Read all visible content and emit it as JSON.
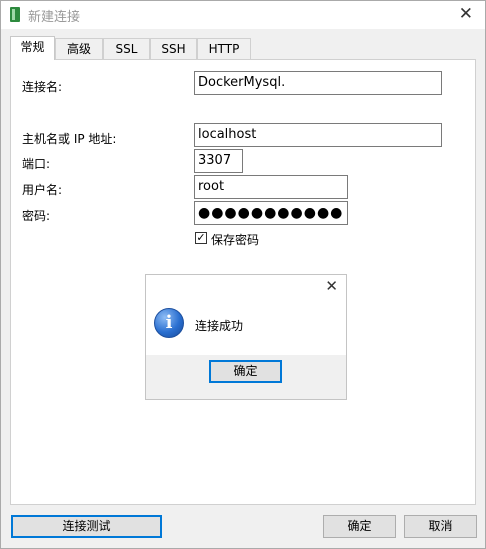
{
  "window": {
    "title": "新建连接",
    "close_glyph": "✕"
  },
  "tabs": [
    {
      "label": "常规",
      "active": true
    },
    {
      "label": "高级"
    },
    {
      "label": "SSL"
    },
    {
      "label": "SSH"
    },
    {
      "label": "HTTP"
    }
  ],
  "form": {
    "connection_name_label": "连接名:",
    "connection_name_value": "DockerMysql.",
    "host_label": "主机名或 IP 地址:",
    "host_value": "localhost",
    "port_label": "端口:",
    "port_value": "3307",
    "user_label": "用户名:",
    "user_value": "root",
    "password_label": "密码:",
    "password_value": "●●●●●●●●●●●",
    "save_password_label": "保存密码",
    "save_password_checked": true,
    "checkmark_glyph": "✓"
  },
  "message_box": {
    "text": "连接成功",
    "ok_label": "确定",
    "close_glyph": "✕",
    "icon": "info-icon",
    "icon_glyph": "i"
  },
  "footer": {
    "test_label": "连接测试",
    "ok_label": "确定",
    "cancel_label": "取消"
  },
  "colors": {
    "accent": "#0078d7",
    "app_icon": "#2d8a3e"
  }
}
